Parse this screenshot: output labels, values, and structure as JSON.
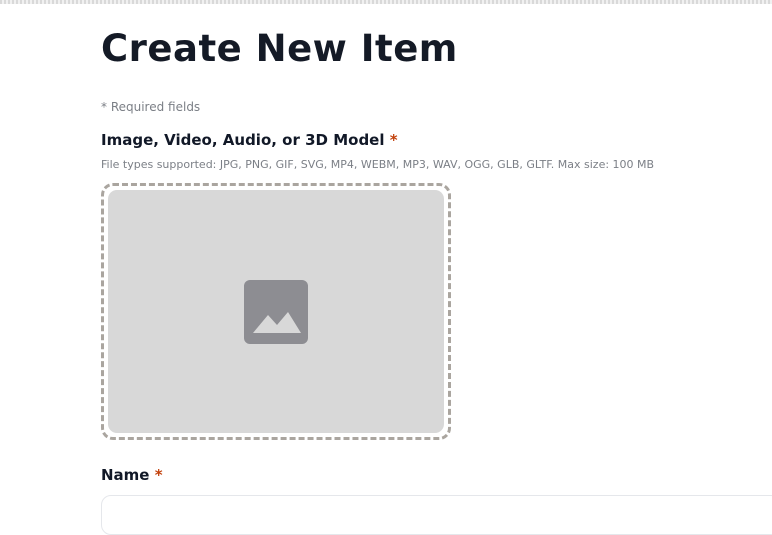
{
  "page": {
    "title": "Create New Item",
    "required_note": "* Required fields"
  },
  "media_field": {
    "label": "Image, Video, Audio, or 3D Model",
    "required_mark": "*",
    "hint": "File types supported: JPG, PNG, GIF, SVG, MP4, WEBM, MP3, WAV, OGG, GLB, GLTF. Max size: 100 MB",
    "icon": "image-placeholder-icon"
  },
  "name_field": {
    "label": "Name",
    "required_mark": "*",
    "value": ""
  },
  "colors": {
    "dropzone_fill": "#d8d8d8",
    "dropzone_border": "#aaa59f",
    "required_mark": "#c2410c",
    "icon": "#8d8d92"
  }
}
